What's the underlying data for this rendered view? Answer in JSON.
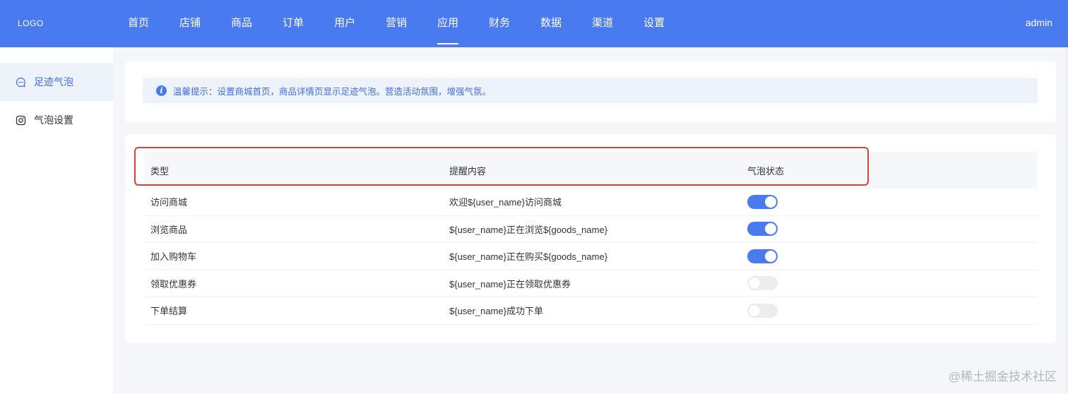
{
  "header": {
    "logo": "LOGO",
    "nav": [
      {
        "label": "首页"
      },
      {
        "label": "店铺"
      },
      {
        "label": "商品"
      },
      {
        "label": "订单"
      },
      {
        "label": "用户"
      },
      {
        "label": "营销"
      },
      {
        "label": "应用",
        "active": true
      },
      {
        "label": "财务"
      },
      {
        "label": "数据"
      },
      {
        "label": "渠道"
      },
      {
        "label": "设置"
      }
    ],
    "user": "admin"
  },
  "sidebar": {
    "items": [
      {
        "label": "足迹气泡",
        "icon": "chat-bubble-icon",
        "active": true
      },
      {
        "label": "气泡设置",
        "icon": "instagram-icon",
        "active": false
      }
    ]
  },
  "tip": {
    "icon": "info-icon",
    "text": "温馨提示：设置商城首页，商品详情页显示足迹气泡。营造活动氛围，增强气氛。"
  },
  "table": {
    "headers": [
      "类型",
      "提醒内容",
      "气泡状态"
    ],
    "rows": [
      {
        "type": "访问商城",
        "content": "欢迎${user_name}访问商城",
        "enabled": true
      },
      {
        "type": "浏览商品",
        "content": "${user_name}正在浏览${goods_name}",
        "enabled": true
      },
      {
        "type": "加入购物车",
        "content": "${user_name}正在购买${goods_name}",
        "enabled": true
      },
      {
        "type": "领取优惠券",
        "content": "${user_name}正在领取优惠券",
        "enabled": false
      },
      {
        "type": "下单结算",
        "content": "${user_name}成功下单",
        "enabled": false
      }
    ]
  },
  "colors": {
    "brand": "#4a7af0",
    "highlight_border": "#d9442f"
  },
  "watermark": "@稀土掘金技术社区"
}
